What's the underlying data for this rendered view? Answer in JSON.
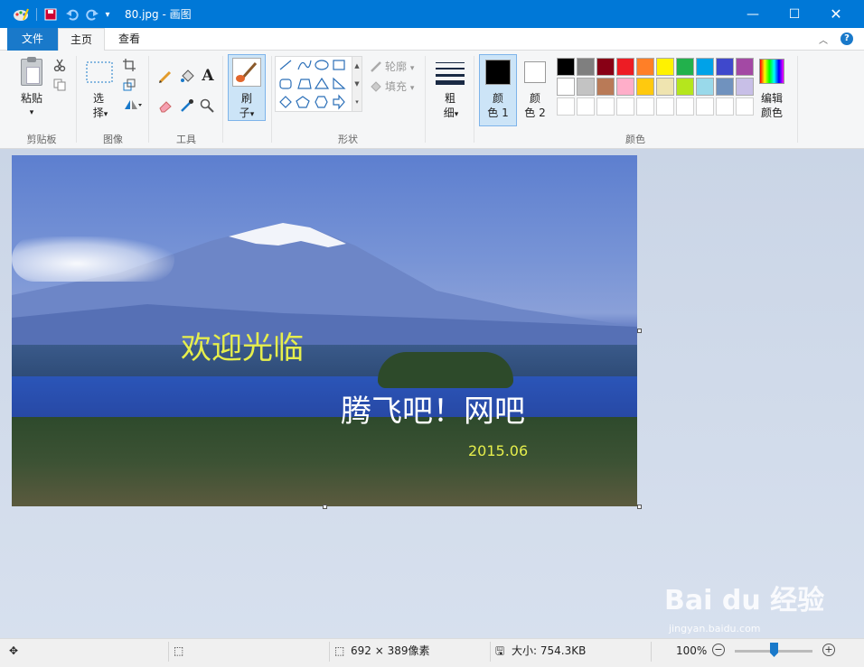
{
  "window": {
    "title": "80.jpg - 画图",
    "min_glyph": "—",
    "max_glyph": "☐",
    "close_glyph": "✕"
  },
  "tabs": [
    {
      "label": "文件"
    },
    {
      "label": "主页"
    },
    {
      "label": "查看"
    }
  ],
  "ribbon": {
    "clipboard": {
      "paste": "粘贴",
      "group": "剪贴板"
    },
    "image": {
      "select_l1": "选",
      "select_l2": "择",
      "group": "图像"
    },
    "tools": {
      "group": "工具",
      "text_glyph": "A"
    },
    "brushes": {
      "l1": "刷",
      "l2": "子"
    },
    "shapes": {
      "outline": "轮廓",
      "fill": "填充",
      "group": "形状"
    },
    "size": {
      "l1": "粗",
      "l2": "细"
    },
    "colors": {
      "color1_l1": "颜",
      "color1_l2": "色 1",
      "color2_l1": "颜",
      "color2_l2": "色 2",
      "edit_l1": "编辑",
      "edit_l2": "颜色",
      "group": "颜色",
      "color1_value": "#000000",
      "color2_value": "#ffffff",
      "palette_row1": [
        "#000000",
        "#7f7f7f",
        "#880015",
        "#ed1c24",
        "#ff7f27",
        "#fff200",
        "#22b14c",
        "#00a2e8",
        "#3f48cc",
        "#a349a4"
      ],
      "palette_row2": [
        "#ffffff",
        "#c3c3c3",
        "#b97a57",
        "#ffaec9",
        "#ffc90e",
        "#efe4b0",
        "#b5e61d",
        "#99d9ea",
        "#7092be",
        "#c8bfe7"
      ],
      "palette_row3": [
        "#ffffff",
        "#ffffff",
        "#ffffff",
        "#ffffff",
        "#ffffff",
        "#ffffff",
        "#ffffff",
        "#ffffff",
        "#ffffff",
        "#ffffff"
      ]
    }
  },
  "canvas": {
    "text_welcome": "欢迎光临",
    "text_name": "腾飞吧！网吧",
    "text_date": "2015.06"
  },
  "status": {
    "dimensions": "692 × 389像素",
    "size": "大小: 754.3KB",
    "zoom": "100%",
    "zoom_fraction": 0.5
  },
  "watermark": {
    "main": "Bai du 经验",
    "sub": "jingyan.baidu.com"
  }
}
